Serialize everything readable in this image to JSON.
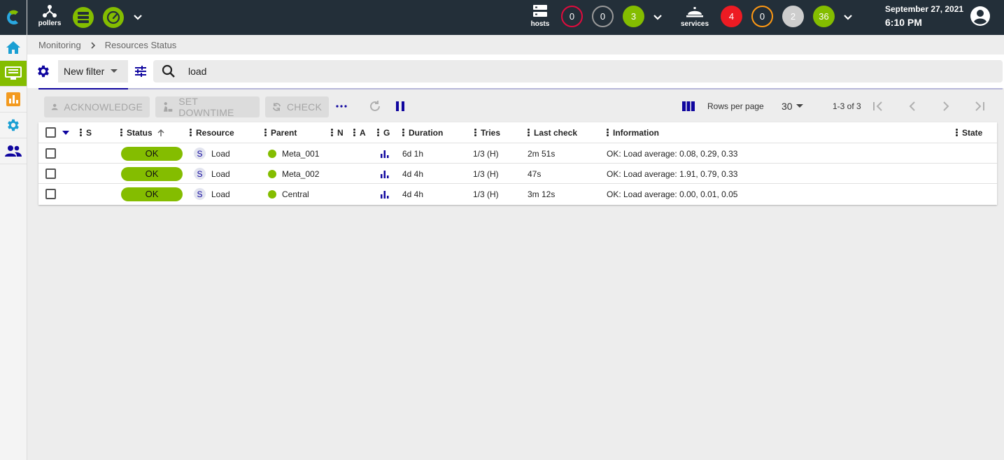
{
  "header": {
    "pollers_label": "pollers",
    "hosts_label": "hosts",
    "services_label": "services",
    "host_counts": {
      "down": "0",
      "unreachable": "0",
      "up": "3"
    },
    "service_counts": {
      "critical": "4",
      "warning": "0",
      "unknown": "2",
      "ok": "36"
    },
    "date": "September 27, 2021",
    "time": "6:10 PM"
  },
  "breadcrumb": {
    "first": "Monitoring",
    "second": "Resources Status"
  },
  "filter": {
    "selected": "New filter",
    "search_value": "load"
  },
  "actions": {
    "acknowledge": "ACKNOWLEDGE",
    "set_downtime": "SET DOWNTIME",
    "check": "CHECK",
    "rows_per_page_label": "Rows per page",
    "rows_per_page_value": "30",
    "page_info": "1-3 of 3"
  },
  "table": {
    "headers": {
      "s": "S",
      "status": "Status",
      "resource": "Resource",
      "parent": "Parent",
      "n": "N",
      "a": "A",
      "g": "G",
      "duration": "Duration",
      "tries": "Tries",
      "last_check": "Last check",
      "information": "Information",
      "state": "State"
    },
    "rows": [
      {
        "status": "OK",
        "type": "S",
        "resource": "Load",
        "parent": "Meta_001",
        "duration": "6d 1h",
        "tries": "1/3 (H)",
        "last_check": "2m 51s",
        "information": "OK: Load average: 0.08, 0.29, 0.33"
      },
      {
        "status": "OK",
        "type": "S",
        "resource": "Load",
        "parent": "Meta_002",
        "duration": "4d 4h",
        "tries": "1/3 (H)",
        "last_check": "47s",
        "information": "OK: Load average: 1.91, 0.79, 0.33"
      },
      {
        "status": "OK",
        "type": "S",
        "resource": "Load",
        "parent": "Central",
        "duration": "4d 4h",
        "tries": "1/3 (H)",
        "last_check": "3m 12s",
        "information": "OK: Load average: 0.00, 0.01, 0.05"
      }
    ]
  },
  "colors": {
    "header_bg": "#232f39",
    "accent_green": "#84bd00",
    "accent_blue": "#10069f",
    "critical_red": "#ed1b23",
    "warning_orange": "#ff9913"
  }
}
